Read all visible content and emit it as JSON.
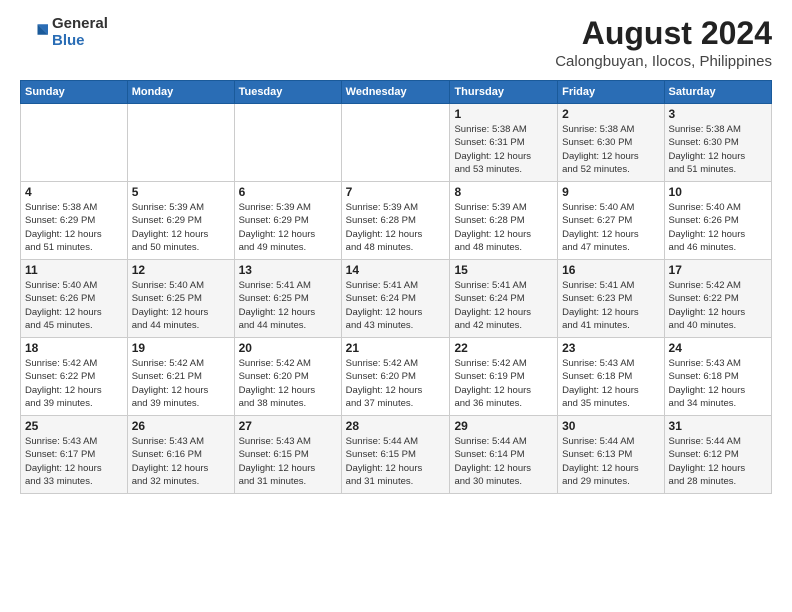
{
  "header": {
    "logo": {
      "line1": "General",
      "line2": "Blue"
    },
    "title": "August 2024",
    "subtitle": "Calongbuyan, Ilocos, Philippines"
  },
  "weekdays": [
    "Sunday",
    "Monday",
    "Tuesday",
    "Wednesday",
    "Thursday",
    "Friday",
    "Saturday"
  ],
  "weeks": [
    [
      {
        "day": "",
        "info": ""
      },
      {
        "day": "",
        "info": ""
      },
      {
        "day": "",
        "info": ""
      },
      {
        "day": "",
        "info": ""
      },
      {
        "day": "1",
        "info": "Sunrise: 5:38 AM\nSunset: 6:31 PM\nDaylight: 12 hours\nand 53 minutes."
      },
      {
        "day": "2",
        "info": "Sunrise: 5:38 AM\nSunset: 6:30 PM\nDaylight: 12 hours\nand 52 minutes."
      },
      {
        "day": "3",
        "info": "Sunrise: 5:38 AM\nSunset: 6:30 PM\nDaylight: 12 hours\nand 51 minutes."
      }
    ],
    [
      {
        "day": "4",
        "info": "Sunrise: 5:38 AM\nSunset: 6:29 PM\nDaylight: 12 hours\nand 51 minutes."
      },
      {
        "day": "5",
        "info": "Sunrise: 5:39 AM\nSunset: 6:29 PM\nDaylight: 12 hours\nand 50 minutes."
      },
      {
        "day": "6",
        "info": "Sunrise: 5:39 AM\nSunset: 6:29 PM\nDaylight: 12 hours\nand 49 minutes."
      },
      {
        "day": "7",
        "info": "Sunrise: 5:39 AM\nSunset: 6:28 PM\nDaylight: 12 hours\nand 48 minutes."
      },
      {
        "day": "8",
        "info": "Sunrise: 5:39 AM\nSunset: 6:28 PM\nDaylight: 12 hours\nand 48 minutes."
      },
      {
        "day": "9",
        "info": "Sunrise: 5:40 AM\nSunset: 6:27 PM\nDaylight: 12 hours\nand 47 minutes."
      },
      {
        "day": "10",
        "info": "Sunrise: 5:40 AM\nSunset: 6:26 PM\nDaylight: 12 hours\nand 46 minutes."
      }
    ],
    [
      {
        "day": "11",
        "info": "Sunrise: 5:40 AM\nSunset: 6:26 PM\nDaylight: 12 hours\nand 45 minutes."
      },
      {
        "day": "12",
        "info": "Sunrise: 5:40 AM\nSunset: 6:25 PM\nDaylight: 12 hours\nand 44 minutes."
      },
      {
        "day": "13",
        "info": "Sunrise: 5:41 AM\nSunset: 6:25 PM\nDaylight: 12 hours\nand 44 minutes."
      },
      {
        "day": "14",
        "info": "Sunrise: 5:41 AM\nSunset: 6:24 PM\nDaylight: 12 hours\nand 43 minutes."
      },
      {
        "day": "15",
        "info": "Sunrise: 5:41 AM\nSunset: 6:24 PM\nDaylight: 12 hours\nand 42 minutes."
      },
      {
        "day": "16",
        "info": "Sunrise: 5:41 AM\nSunset: 6:23 PM\nDaylight: 12 hours\nand 41 minutes."
      },
      {
        "day": "17",
        "info": "Sunrise: 5:42 AM\nSunset: 6:22 PM\nDaylight: 12 hours\nand 40 minutes."
      }
    ],
    [
      {
        "day": "18",
        "info": "Sunrise: 5:42 AM\nSunset: 6:22 PM\nDaylight: 12 hours\nand 39 minutes."
      },
      {
        "day": "19",
        "info": "Sunrise: 5:42 AM\nSunset: 6:21 PM\nDaylight: 12 hours\nand 39 minutes."
      },
      {
        "day": "20",
        "info": "Sunrise: 5:42 AM\nSunset: 6:20 PM\nDaylight: 12 hours\nand 38 minutes."
      },
      {
        "day": "21",
        "info": "Sunrise: 5:42 AM\nSunset: 6:20 PM\nDaylight: 12 hours\nand 37 minutes."
      },
      {
        "day": "22",
        "info": "Sunrise: 5:42 AM\nSunset: 6:19 PM\nDaylight: 12 hours\nand 36 minutes."
      },
      {
        "day": "23",
        "info": "Sunrise: 5:43 AM\nSunset: 6:18 PM\nDaylight: 12 hours\nand 35 minutes."
      },
      {
        "day": "24",
        "info": "Sunrise: 5:43 AM\nSunset: 6:18 PM\nDaylight: 12 hours\nand 34 minutes."
      }
    ],
    [
      {
        "day": "25",
        "info": "Sunrise: 5:43 AM\nSunset: 6:17 PM\nDaylight: 12 hours\nand 33 minutes."
      },
      {
        "day": "26",
        "info": "Sunrise: 5:43 AM\nSunset: 6:16 PM\nDaylight: 12 hours\nand 32 minutes."
      },
      {
        "day": "27",
        "info": "Sunrise: 5:43 AM\nSunset: 6:15 PM\nDaylight: 12 hours\nand 31 minutes."
      },
      {
        "day": "28",
        "info": "Sunrise: 5:44 AM\nSunset: 6:15 PM\nDaylight: 12 hours\nand 31 minutes."
      },
      {
        "day": "29",
        "info": "Sunrise: 5:44 AM\nSunset: 6:14 PM\nDaylight: 12 hours\nand 30 minutes."
      },
      {
        "day": "30",
        "info": "Sunrise: 5:44 AM\nSunset: 6:13 PM\nDaylight: 12 hours\nand 29 minutes."
      },
      {
        "day": "31",
        "info": "Sunrise: 5:44 AM\nSunset: 6:12 PM\nDaylight: 12 hours\nand 28 minutes."
      }
    ]
  ]
}
